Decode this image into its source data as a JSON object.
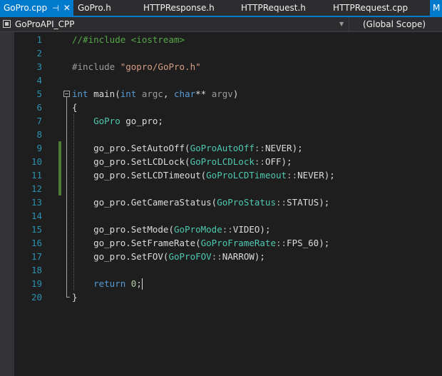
{
  "tabs": [
    {
      "label": "GoPro.cpp",
      "active": true,
      "pinned": true,
      "closable": true
    },
    {
      "label": "GoPro.h"
    },
    {
      "label": "HTTPResponse.h"
    },
    {
      "label": "HTTPRequest.h"
    },
    {
      "label": "HTTPRequest.cpp"
    },
    {
      "label": "M"
    }
  ],
  "navbar": {
    "project": "GoProAPI_CPP",
    "scope": "(Global Scope)"
  },
  "editor": {
    "line_numbers": [
      "1",
      "2",
      "3",
      "4",
      "5",
      "6",
      "7",
      "8",
      "9",
      "10",
      "11",
      "12",
      "13",
      "14",
      "15",
      "16",
      "17",
      "18",
      "19",
      "20"
    ],
    "lines": [
      [
        {
          "t": "//#include <iostream>",
          "c": "comment"
        }
      ],
      [],
      [
        {
          "t": "#include ",
          "c": "pre"
        },
        {
          "t": "\"gopro/GoPro.h\"",
          "c": "str"
        }
      ],
      [],
      [
        {
          "t": "int",
          "c": "kw"
        },
        {
          "t": " main(",
          "c": "plain"
        },
        {
          "t": "int",
          "c": "kw"
        },
        {
          "t": " ",
          "c": "plain"
        },
        {
          "t": "argc",
          "c": "param"
        },
        {
          "t": ", ",
          "c": "plain"
        },
        {
          "t": "char",
          "c": "kw"
        },
        {
          "t": "** ",
          "c": "plain"
        },
        {
          "t": "argv",
          "c": "param"
        },
        {
          "t": ")",
          "c": "plain"
        }
      ],
      [
        {
          "t": "{",
          "c": "plain"
        }
      ],
      [
        {
          "t": "    ",
          "c": "plain"
        },
        {
          "t": "GoPro",
          "c": "type"
        },
        {
          "t": " go_pro;",
          "c": "plain"
        }
      ],
      [],
      [
        {
          "t": "    go_pro.SetAutoOff(",
          "c": "plain"
        },
        {
          "t": "GoProAutoOff",
          "c": "type"
        },
        {
          "t": "::",
          "c": "op"
        },
        {
          "t": "NEVER);",
          "c": "plain"
        }
      ],
      [
        {
          "t": "    go_pro.SetLCDLock(",
          "c": "plain"
        },
        {
          "t": "GoProLCDLock",
          "c": "type"
        },
        {
          "t": "::",
          "c": "op"
        },
        {
          "t": "OFF);",
          "c": "plain"
        }
      ],
      [
        {
          "t": "    go_pro.SetLCDTimeout(",
          "c": "plain"
        },
        {
          "t": "GoProLCDTimeout",
          "c": "type"
        },
        {
          "t": "::",
          "c": "op"
        },
        {
          "t": "NEVER);",
          "c": "plain"
        }
      ],
      [],
      [
        {
          "t": "    go_pro.GetCameraStatus(",
          "c": "plain"
        },
        {
          "t": "GoProStatus",
          "c": "type"
        },
        {
          "t": "::",
          "c": "op"
        },
        {
          "t": "STATUS);",
          "c": "plain"
        }
      ],
      [],
      [
        {
          "t": "    go_pro.SetMode(",
          "c": "plain"
        },
        {
          "t": "GoProMode",
          "c": "type"
        },
        {
          "t": "::",
          "c": "op"
        },
        {
          "t": "VIDEO);",
          "c": "plain"
        }
      ],
      [
        {
          "t": "    go_pro.SetFrameRate(",
          "c": "plain"
        },
        {
          "t": "GoProFrameRate",
          "c": "type"
        },
        {
          "t": "::",
          "c": "op"
        },
        {
          "t": "FPS_60);",
          "c": "plain"
        }
      ],
      [
        {
          "t": "    go_pro.SetFOV(",
          "c": "plain"
        },
        {
          "t": "GoProFOV",
          "c": "type"
        },
        {
          "t": "::",
          "c": "op"
        },
        {
          "t": "NARROW);",
          "c": "plain"
        }
      ],
      [],
      [
        {
          "t": "    ",
          "c": "plain"
        },
        {
          "t": "return",
          "c": "kw"
        },
        {
          "t": " ",
          "c": "plain"
        },
        {
          "t": "0",
          "c": "num"
        },
        {
          "t": ";",
          "c": "plain"
        }
      ],
      [
        {
          "t": "}",
          "c": "plain"
        }
      ]
    ]
  }
}
